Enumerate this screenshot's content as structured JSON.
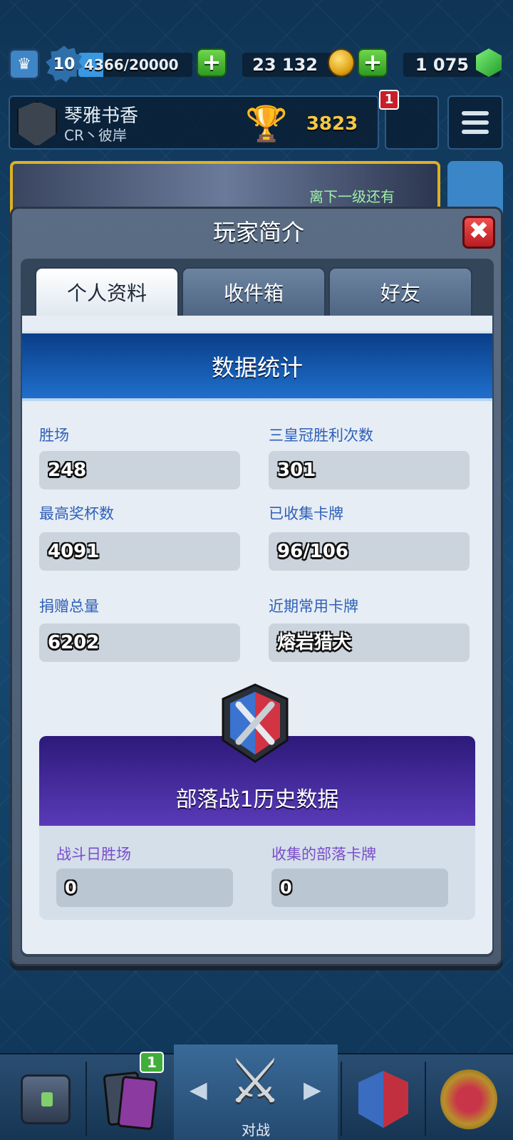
{
  "top_bar": {
    "level": "10",
    "xp_text": "4366/20000",
    "xp_progress": 0.2183,
    "gold": "23 132",
    "gems": "1 075"
  },
  "profile": {
    "player_name": "琴雅书香",
    "clan_name": "CR丶彼岸",
    "trophies": "3823",
    "notification_count": "1"
  },
  "banner": {
    "text": "离下一级还有"
  },
  "modal": {
    "title": "玩家简介",
    "close_symbol": "✖",
    "tabs": [
      {
        "label": "个人资料",
        "active": true
      },
      {
        "label": "收件箱",
        "active": false
      },
      {
        "label": "好友",
        "active": false
      }
    ],
    "stats_header": "数据统计",
    "stats": [
      {
        "label": "胜场",
        "value": "248"
      },
      {
        "label": "三皇冠胜利次数",
        "value": "301"
      },
      {
        "label": "最高奖杯数",
        "value": "4091"
      },
      {
        "label": "已收集卡牌",
        "value": "96/106"
      },
      {
        "label": "捐赠总量",
        "value": "6202"
      },
      {
        "label": "近期常用卡牌",
        "value": "熔岩猎犬"
      }
    ],
    "clan_war": {
      "title": "部落战1历史数据",
      "stats": [
        {
          "label": "战斗日胜场",
          "value": "0"
        },
        {
          "label": "收集的部落卡牌",
          "value": "0"
        }
      ]
    }
  },
  "bottom_nav": {
    "cards_badge": "1",
    "battle_label": "对战"
  },
  "colors": {
    "stat_label": "#2f5fb8",
    "war_label": "#7a4ccc",
    "section_header": "#1f6fcc"
  }
}
